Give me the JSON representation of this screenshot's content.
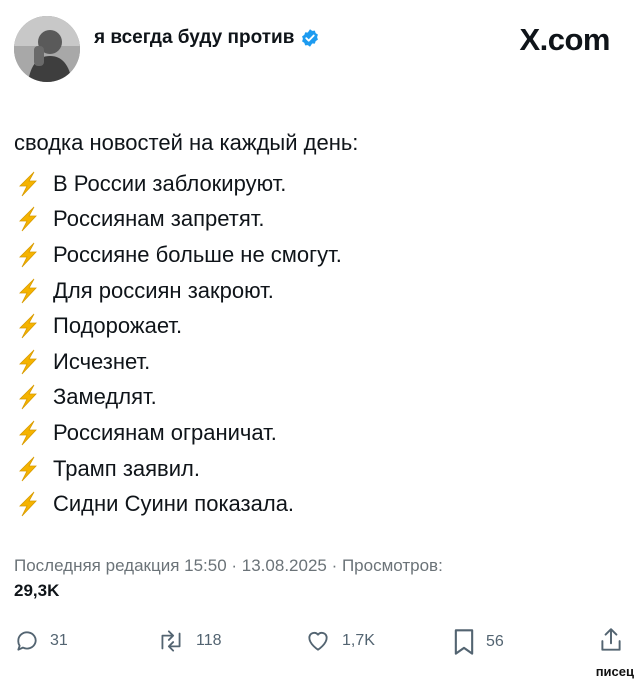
{
  "header": {
    "author_name": "я всегда буду против",
    "brand": "X.com"
  },
  "post": {
    "headline": "сводка новостей на каждый день:",
    "items": [
      "В России заблокируют.",
      "Россиянам запретят.",
      "Россияне больше не смогут.",
      "Для россиян закроют.",
      "Подорожает.",
      "Исчезнет.",
      "Замедлят.",
      "Россиянам ограничат.",
      "Трамп заявил.",
      "Сидни Суини показала."
    ],
    "item_icon": "lightning-bolt-icon",
    "meta": "Последняя редакция 15:50 · 13.08.2025 · Просмотров:",
    "views": "29,3K"
  },
  "actions": {
    "reply_count": "31",
    "repost_count": "118",
    "like_count": "1,7K",
    "bookmark_count": "56"
  },
  "watermark": "писец",
  "colors": {
    "text": "#0f1419",
    "muted": "#536471",
    "verified": "#1d9bf0",
    "bolt": "#f5b300"
  }
}
